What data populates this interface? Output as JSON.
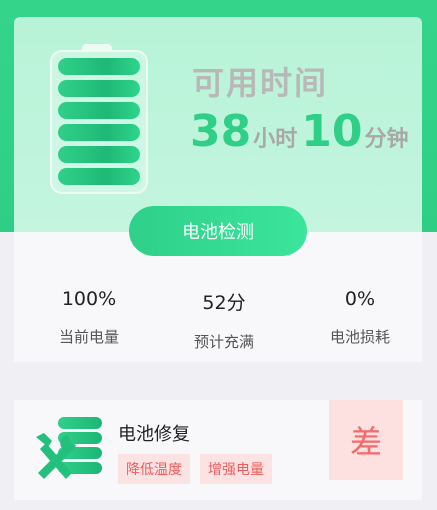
{
  "header": {
    "available_title": "可用时间",
    "hours": "38",
    "hours_unit": "小时",
    "minutes": "10",
    "minutes_unit": "分钟"
  },
  "battery": {
    "level_percent": 100,
    "bars": 6
  },
  "detect_button": {
    "label": "电池检测"
  },
  "stats": [
    {
      "value": "100%",
      "label": "当前电量"
    },
    {
      "value": "52分",
      "label": "预计充满"
    },
    {
      "value": "0%",
      "label": "电池损耗"
    }
  ],
  "repair": {
    "title": "电池修复",
    "tags": [
      "降低温度",
      "增强电量"
    ],
    "grade": "差",
    "icon": "battery-wrench-icon"
  },
  "colors": {
    "accent": "#2fcf87",
    "warn": "#f25b5b"
  }
}
